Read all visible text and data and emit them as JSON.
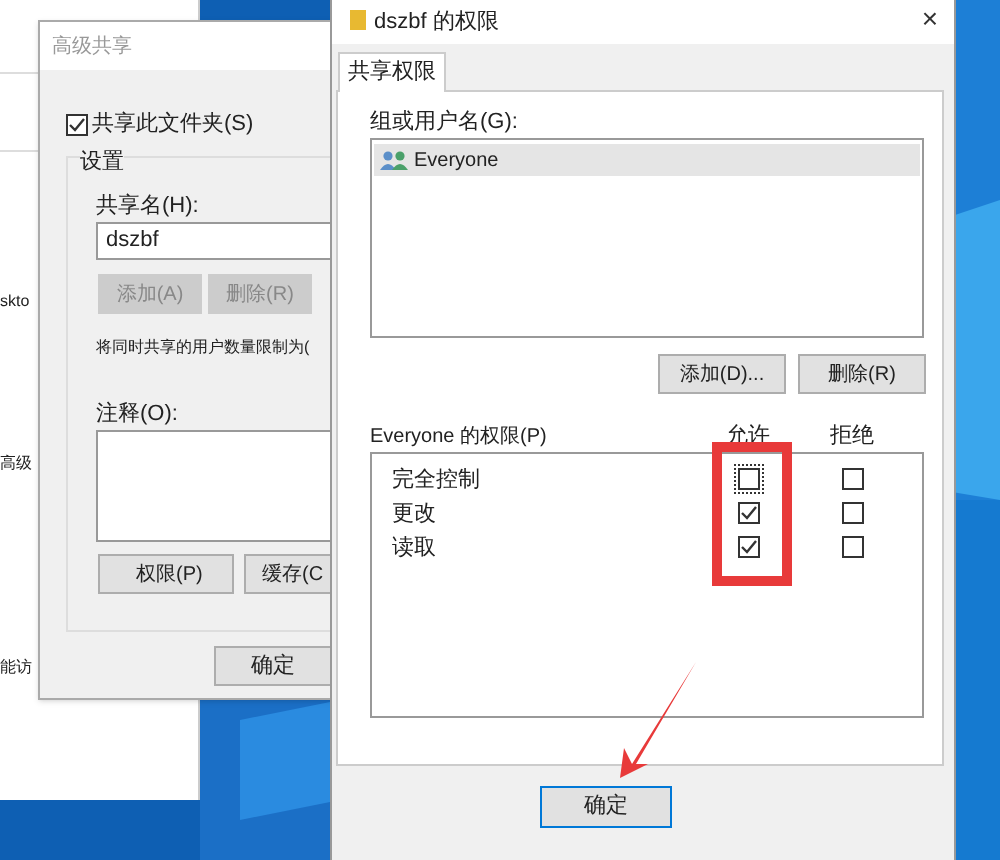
{
  "background_window": {
    "fragments": [
      "skto",
      "高级",
      "能访"
    ]
  },
  "advanced_sharing": {
    "title": "高级共享",
    "share_checkbox": {
      "label": "共享此文件夹(S)",
      "checked": true
    },
    "settings_label": "设置",
    "share_name_label": "共享名(H):",
    "share_name": "dszbf",
    "name_buttons": [
      {
        "label": "添加(A)",
        "disabled": true
      },
      {
        "label": "删除(R)",
        "disabled": true
      }
    ],
    "limit_text": "将同时共享的用户数量限制为(",
    "comment_label": "注释(O):",
    "bottom_buttons": [
      "权限(P)",
      "缓存(C"
    ],
    "ok_button": "确定"
  },
  "permissions": {
    "title": "dszbf 的权限",
    "close": "×",
    "tabs": [
      {
        "label": "共享权限",
        "selected": true
      }
    ],
    "group_label": "组或用户名(G):",
    "users": [
      {
        "name": "Everyone",
        "selected": true
      }
    ],
    "user_buttons": [
      "添加(D)...",
      "删除(R)"
    ],
    "perm_label": "Everyone 的权限(P)",
    "columns": [
      "允许",
      "拒绝"
    ],
    "rows": [
      {
        "name": "完全控制",
        "allow": false,
        "deny": false,
        "focused": true
      },
      {
        "name": "更改",
        "allow": true,
        "deny": false,
        "focused": false
      },
      {
        "name": "读取",
        "allow": true,
        "deny": false,
        "focused": false
      }
    ],
    "ok_button": "确定"
  }
}
